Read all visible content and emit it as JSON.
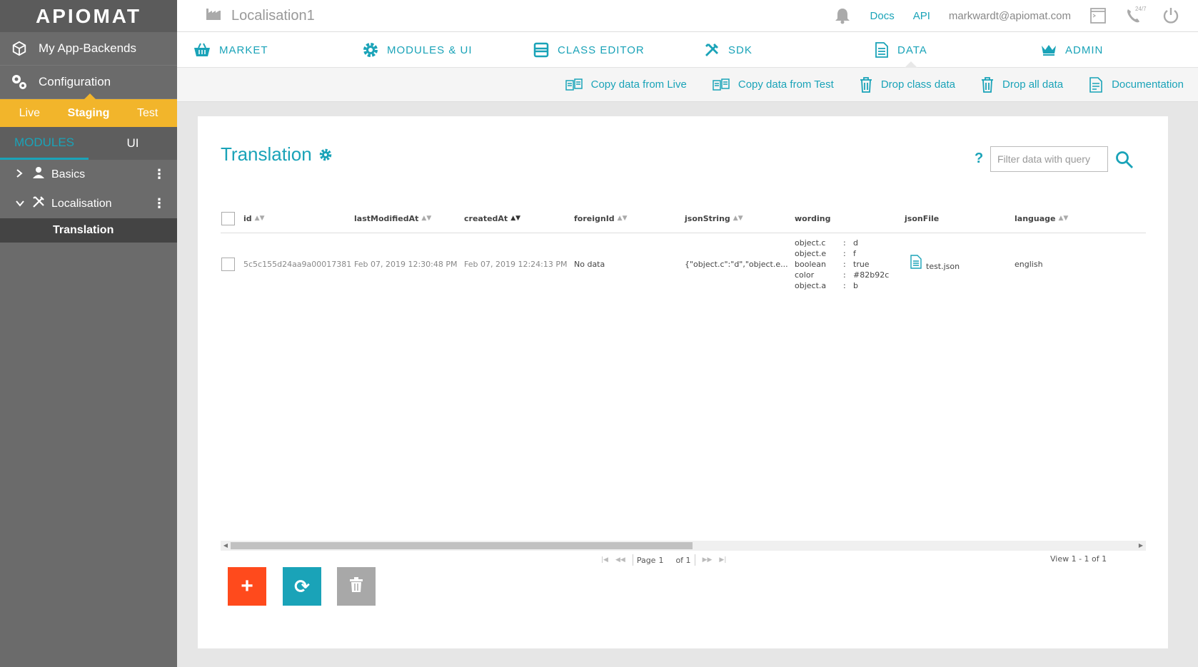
{
  "brand": {
    "logo_text": "APIOMAT"
  },
  "sidebar": {
    "nav": [
      {
        "label": "My App-Backends",
        "icon": "cube-icon"
      },
      {
        "label": "Configuration",
        "icon": "gears-icon"
      }
    ],
    "environments": [
      "Live",
      "Staging",
      "Test"
    ],
    "active_environment": "Staging",
    "module_tabs": [
      "MODULES",
      "UI"
    ],
    "active_module_tab": "MODULES",
    "tree": [
      {
        "label": "Basics",
        "expanded": false,
        "icon": "user-icon"
      },
      {
        "label": "Localisation",
        "expanded": true,
        "icon": "tools-icon",
        "children": [
          "Translation"
        ]
      }
    ]
  },
  "topbar": {
    "app_name": "Localisation1",
    "links": [
      "Docs",
      "API"
    ],
    "user_email": "markwardt@apiomat.com",
    "icons": [
      "bell-icon",
      "terminal-icon",
      "support-phone-icon",
      "power-icon"
    ],
    "support_badge": "24/7"
  },
  "main_nav": [
    {
      "label": "MARKET",
      "icon": "basket-icon"
    },
    {
      "label": "MODULES & UI",
      "icon": "gear-icon"
    },
    {
      "label": "CLASS EDITOR",
      "icon": "window-icon"
    },
    {
      "label": "SDK",
      "icon": "tools-icon"
    },
    {
      "label": "DATA",
      "icon": "document-icon",
      "active": true
    },
    {
      "label": "ADMIN",
      "icon": "crown-icon"
    }
  ],
  "sub_actions": [
    {
      "label": "Copy data from Live",
      "icon": "copy-data-icon"
    },
    {
      "label": "Copy data from Test",
      "icon": "copy-data-icon"
    },
    {
      "label": "Drop class data",
      "icon": "trash-icon"
    },
    {
      "label": "Drop all data",
      "icon": "trash-icon"
    },
    {
      "label": "Documentation",
      "icon": "doc-icon"
    }
  ],
  "card": {
    "title": "Translation",
    "help": "?",
    "filter_placeholder": "Filter data with query"
  },
  "table": {
    "columns": [
      "id",
      "lastModifiedAt",
      "createdAt",
      "foreignId",
      "jsonString",
      "wording",
      "jsonFile",
      "language"
    ],
    "sorted_column": "createdAt",
    "rows": [
      {
        "id": "5c5c155d24aa9a00017381",
        "lastModifiedAt": "Feb 07, 2019 12:30:48 PM",
        "createdAt": "Feb 07, 2019 12:24:13 PM",
        "foreignId": "No data",
        "jsonString": "{\"object.c\":\"d\",\"object.e...",
        "wording": [
          {
            "key": "object.c",
            "sep": ":",
            "value": "d"
          },
          {
            "key": "object.e",
            "sep": ":",
            "value": "f"
          },
          {
            "key": "boolean",
            "sep": ":",
            "value": "true"
          },
          {
            "key": "color",
            "sep": ":",
            "value": "#82b92c"
          },
          {
            "key": "object.a",
            "sep": ":",
            "value": "b"
          }
        ],
        "jsonFile": "test.json",
        "language": "english"
      }
    ]
  },
  "pager": {
    "page_label": "Page",
    "page": "1",
    "of_label": "of 1",
    "view_info": "View 1 - 1 of 1",
    "scroll_fraction": 0.51
  },
  "actions": {
    "add_symbol": "+",
    "refresh_symbol": "⟳"
  },
  "colors": {
    "accent": "#1aa3b8",
    "environment_bar": "#f2b52b",
    "add_button": "#ff4a1c",
    "delete_button": "#a8a8a8",
    "sidebar": "#6b6b6b"
  }
}
